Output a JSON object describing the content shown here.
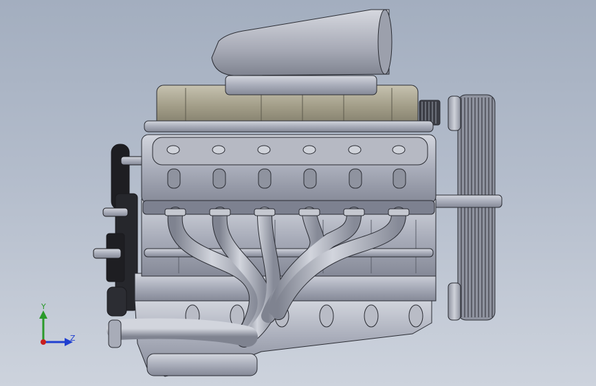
{
  "viewport": {
    "background_top": "#a3aebf",
    "background_bottom": "#cdd3dd"
  },
  "model": {
    "parts": [
      "intake-scoop",
      "supercharger",
      "valve-cover",
      "exhaust-headers",
      "oil-pan",
      "drive-belt-pulleys",
      "front-pulleys"
    ],
    "colors": {
      "metal_light": "#c9ccd6",
      "metal_mid": "#9a9eac",
      "metal_dark": "#6c707c",
      "blower_tan": "#a8a38e",
      "pulley_black": "#1e1e22",
      "edge": "#2a2c33"
    }
  },
  "triad": {
    "y_label": "Y",
    "z_label": "Z",
    "y_color": "#2a9a2a",
    "z_color": "#1f3fd0",
    "x_color": "#c81e1e"
  }
}
